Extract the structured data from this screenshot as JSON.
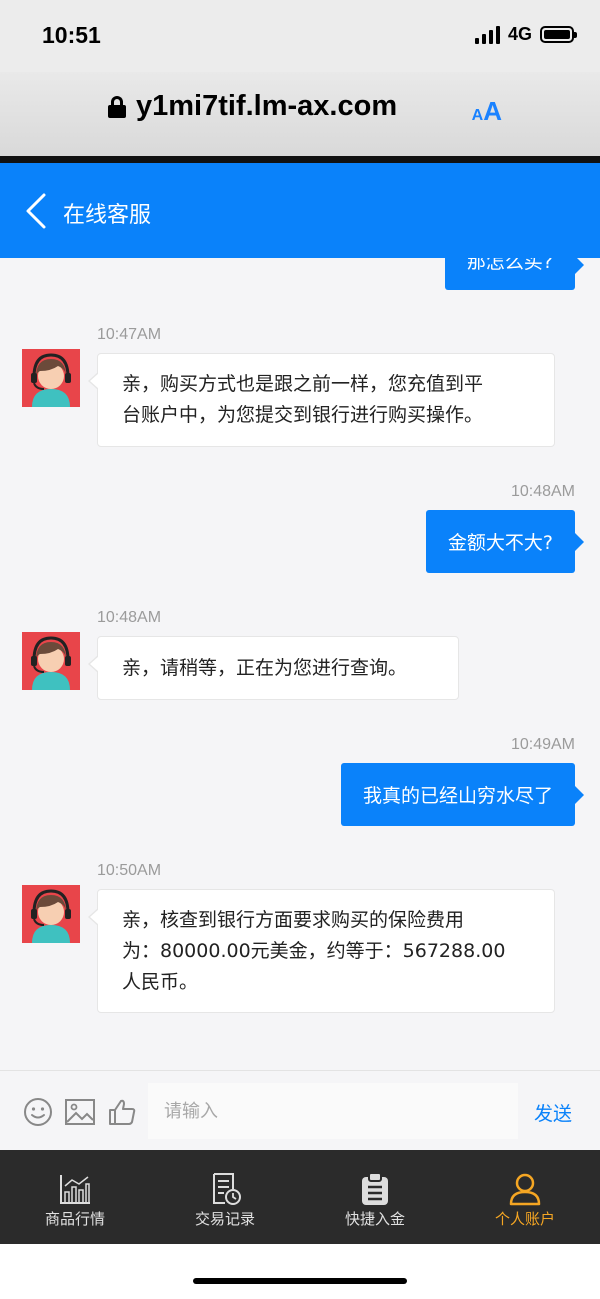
{
  "status_bar": {
    "time": "10:51",
    "network": "4G"
  },
  "browser": {
    "url": "y1mi7tif.lm-ax.com",
    "aa_small": "A",
    "aa_big": "A"
  },
  "header": {
    "title": "在线客服"
  },
  "messages": [
    {
      "direction": "out",
      "text": "那怎么买?"
    },
    {
      "direction": "in",
      "time": "10:47AM",
      "lines": [
        "亲，购买方式也是跟之前一样，您充值到平",
        "台账户中，为您提交到银行进行购买操作。"
      ]
    },
    {
      "direction": "out",
      "time": "10:48AM",
      "text": "金额大不大?"
    },
    {
      "direction": "in",
      "time": "10:48AM",
      "lines": [
        "亲，请稍等，正在为您进行查询。"
      ]
    },
    {
      "direction": "out",
      "time": "10:49AM",
      "text": "我真的已经山穷水尽了"
    },
    {
      "direction": "in",
      "time": "10:50AM",
      "lines": [
        "亲，核查到银行方面要求购买的保险费用",
        "为：80000.00元美金，约等于：567288.00",
        "人民币。"
      ]
    }
  ],
  "input": {
    "placeholder": "请输入",
    "value": "",
    "send_label": "发送"
  },
  "tabs": [
    {
      "label": "商品行情",
      "icon": "chart-icon",
      "active": false
    },
    {
      "label": "交易记录",
      "icon": "records-icon",
      "active": false
    },
    {
      "label": "快捷入金",
      "icon": "clipboard-icon",
      "active": false
    },
    {
      "label": "个人账户",
      "icon": "person-icon",
      "active": true
    }
  ],
  "colors": {
    "primary": "#0a82fa",
    "active_tab": "#f5a623",
    "tab_bar": "#2b2b2b",
    "avatar_bg": "#e8454a"
  }
}
